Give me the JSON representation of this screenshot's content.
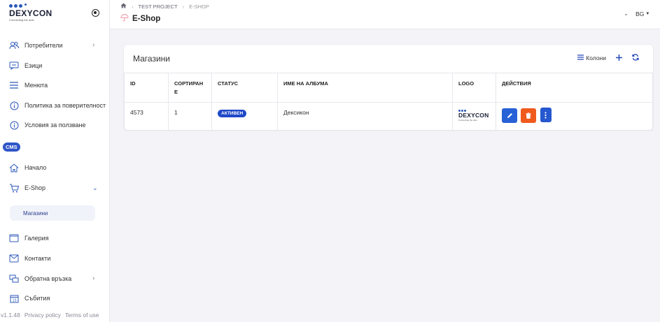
{
  "brand": {
    "name": "DEXYCON",
    "tagline": "Connecting the dots"
  },
  "sidebar": {
    "items": [
      {
        "label": "Потребители",
        "icon": "users-icon",
        "has_children": true
      },
      {
        "label": "Езици",
        "icon": "languages-icon",
        "has_children": false
      },
      {
        "label": "Менюта",
        "icon": "menu-icon",
        "has_children": false
      },
      {
        "label": "Политика за поверителност",
        "icon": "info-icon",
        "has_children": false
      },
      {
        "label": "Условия за ползване",
        "icon": "info-icon",
        "has_children": false
      }
    ],
    "cms_badge": "CMS",
    "cms_items": [
      {
        "label": "Начало",
        "icon": "home-icon",
        "has_children": false
      },
      {
        "label": "E-Shop",
        "icon": "cart-icon",
        "has_children": true,
        "expanded": true
      },
      {
        "label": "Галерия",
        "icon": "gallery-icon",
        "has_children": false
      },
      {
        "label": "Контакти",
        "icon": "contacts-icon",
        "has_children": false
      },
      {
        "label": "Обратна връзка",
        "icon": "feedback-icon",
        "has_children": true
      },
      {
        "label": "Събития",
        "icon": "calendar-icon",
        "has_children": false
      }
    ],
    "sub_active": "Магазини",
    "footer": {
      "version": "v1.1.48",
      "privacy": "Privacy policy",
      "terms": "Terms of use"
    }
  },
  "header": {
    "breadcrumbs": [
      "TEST PROJECT",
      "E-SHOP"
    ],
    "title": "E-Shop",
    "language": "BG"
  },
  "card": {
    "title": "Магазини",
    "columns_label": "Колони",
    "table": {
      "headers": [
        "ID",
        "СОРТИРАН Е",
        "СТАТУС",
        "ИМЕ НА АЛБУМА",
        "LOGO",
        "ДЕЙСТВИЯ"
      ],
      "rows": [
        {
          "id": "4573",
          "sort": "1",
          "status": "АКТИВЕН",
          "name": "Дексикон",
          "logo_text": "DEXYCON",
          "logo_tag": "Connecting the dots"
        }
      ]
    }
  },
  "colors": {
    "accent": "#2f56c7",
    "edit": "#2860d6",
    "delete": "#ef5a1d",
    "status": "#1f49c8"
  }
}
